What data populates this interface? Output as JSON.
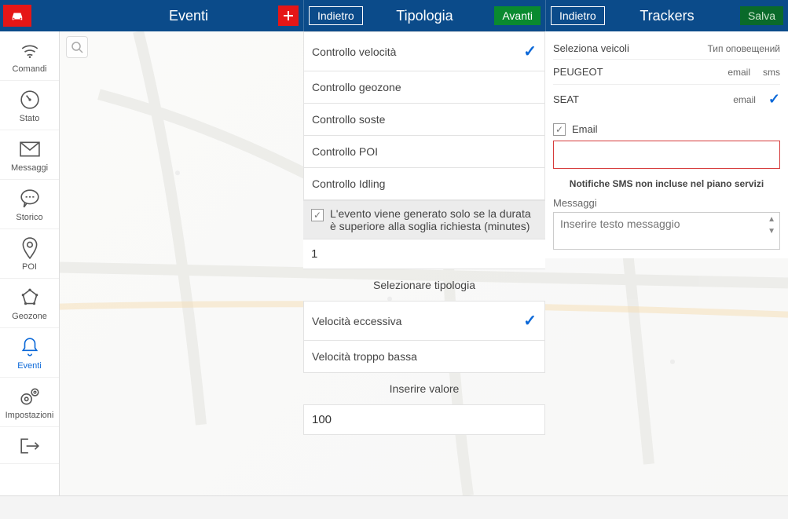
{
  "header": {
    "section1": {
      "title": "Eventi"
    },
    "section2": {
      "back": "Indietro",
      "title": "Tipologia",
      "forward": "Avanti"
    },
    "section3": {
      "back": "Indietro",
      "title": "Trackers",
      "save": "Salva"
    }
  },
  "sidebar": {
    "items": [
      {
        "label": "Comandi"
      },
      {
        "label": "Stato"
      },
      {
        "label": "Messaggi"
      },
      {
        "label": "Storico"
      },
      {
        "label": "POI"
      },
      {
        "label": "Geozone"
      },
      {
        "label": "Eventi"
      },
      {
        "label": "Impostazioni"
      }
    ]
  },
  "tipologia": {
    "controls": [
      {
        "label": "Controllo velocità",
        "checked": true
      },
      {
        "label": "Controllo geozone",
        "checked": false
      },
      {
        "label": "Controllo soste",
        "checked": false
      },
      {
        "label": "Controllo POI",
        "checked": false
      },
      {
        "label": "Controllo Idling",
        "checked": false
      }
    ],
    "duration_note": "L'evento viene generato solo se la durata è superiore alla soglia richiesta (minutes)",
    "duration_value": "1",
    "select_label": "Selezionare tipologia",
    "types": [
      {
        "label": "Velocità eccessiva",
        "checked": true
      },
      {
        "label": "Velocità troppo bassa",
        "checked": false
      }
    ],
    "value_label": "Inserire valore",
    "value": "100"
  },
  "trackers": {
    "select_vehicles": "Seleziona veicoli",
    "notification_type": "Тип оповещений",
    "col_email": "email",
    "col_sms": "sms",
    "vehicles": [
      {
        "name": "PEUGEOT",
        "email": "email",
        "sms": "sms",
        "checked": false
      },
      {
        "name": "SEAT",
        "email": "email",
        "sms": "",
        "checked": true
      }
    ],
    "email_label": "Email",
    "email_value": "",
    "sms_note": "Notifiche SMS non incluse nel piano servizi",
    "messages_label": "Messaggi",
    "messages_placeholder": "Inserire testo messaggio"
  }
}
